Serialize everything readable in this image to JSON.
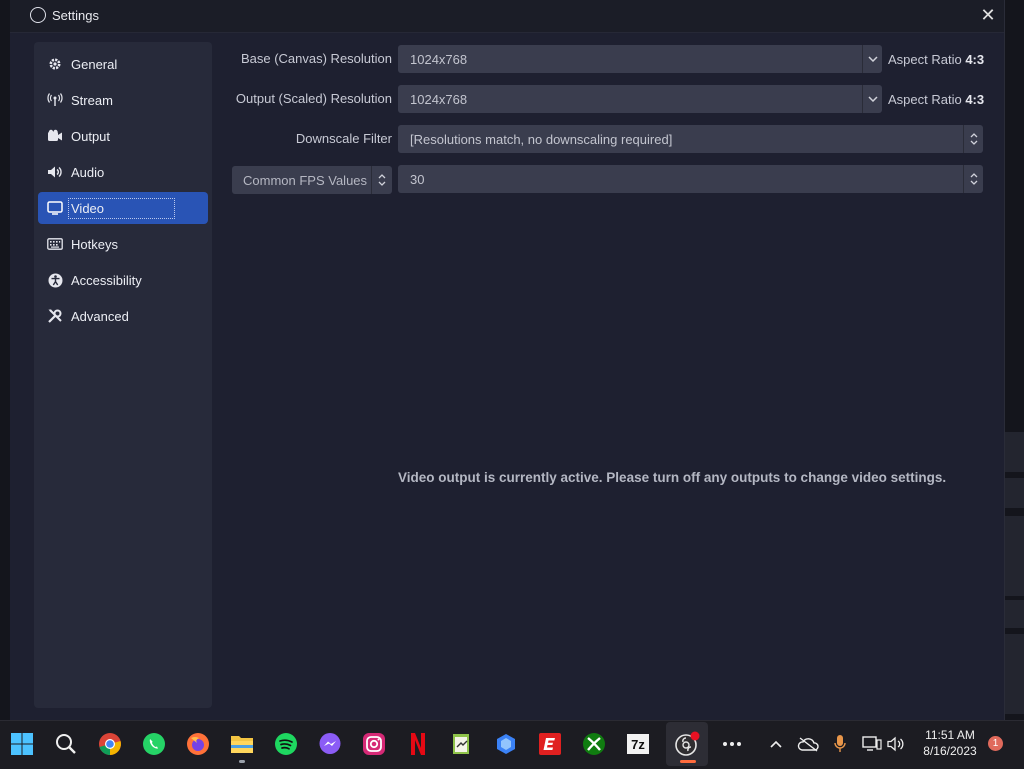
{
  "window": {
    "title": "Settings",
    "close_glyph": "✕"
  },
  "sidebar": {
    "items": [
      {
        "label": "General",
        "icon": "gear-icon"
      },
      {
        "label": "Stream",
        "icon": "broadcast-icon"
      },
      {
        "label": "Output",
        "icon": "output-icon"
      },
      {
        "label": "Audio",
        "icon": "speaker-icon"
      },
      {
        "label": "Video",
        "icon": "monitor-icon",
        "active": true
      },
      {
        "label": "Hotkeys",
        "icon": "keyboard-icon"
      },
      {
        "label": "Accessibility",
        "icon": "accessibility-icon"
      },
      {
        "label": "Advanced",
        "icon": "tools-icon"
      }
    ]
  },
  "video": {
    "base_label": "Base (Canvas) Resolution",
    "base_value": "1024x768",
    "base_aspect_prefix": "Aspect Ratio ",
    "base_aspect_value": "4:3",
    "output_label": "Output (Scaled) Resolution",
    "output_value": "1024x768",
    "output_aspect_prefix": "Aspect Ratio ",
    "output_aspect_value": "4:3",
    "downscale_label": "Downscale Filter",
    "downscale_value": "[Resolutions match, no downscaling required]",
    "fps_type": "Common FPS Values",
    "fps_value": "30",
    "notice": "Video output is currently active. Please turn off any outputs to change video settings."
  },
  "taskbar": {
    "apps": [
      "start-icon",
      "search-icon",
      "chrome-icon",
      "whatsapp-icon",
      "firefox-icon",
      "file-explorer-icon",
      "spotify-icon",
      "messenger-icon",
      "instagram-icon",
      "netflix-icon",
      "notepad-icon",
      "copilot-icon",
      "espn-icon",
      "xbox-icon",
      "7zip-icon",
      "obs-icon",
      "more-icon"
    ],
    "time": "11:51 AM",
    "date": "8/16/2023",
    "notifications": "1"
  },
  "colors": {
    "accent": "#2954b5",
    "netflix": "#e50914",
    "spotify": "#1ed760"
  }
}
